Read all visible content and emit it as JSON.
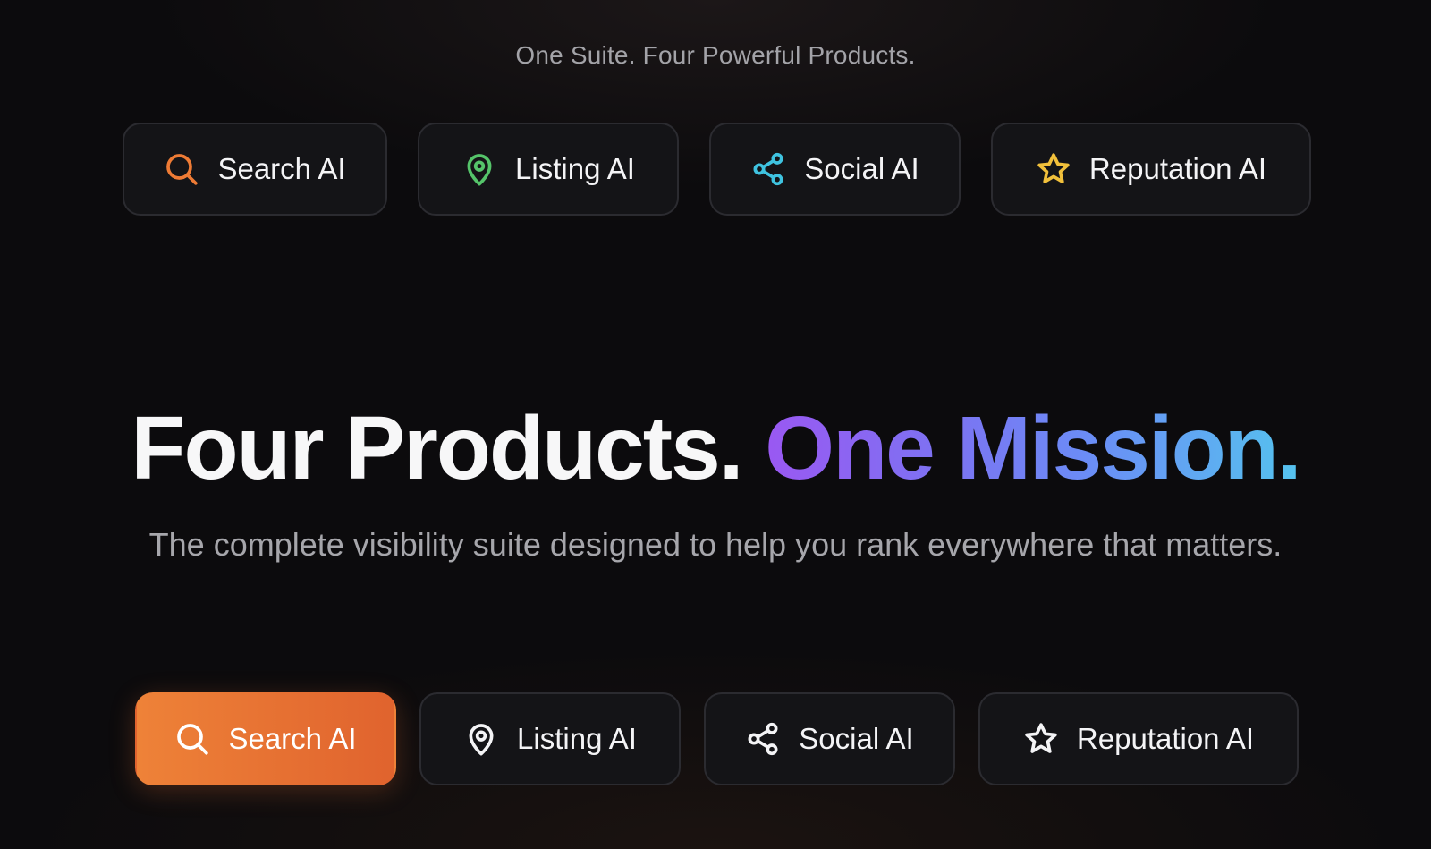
{
  "hero": {
    "eyebrow": "One Suite. Four Powerful Products.",
    "headline_part1": "Four Products.",
    "headline_part2": "One Mission.",
    "subheadline": "The complete visibility suite designed to help you rank everywhere that matters."
  },
  "top_products": [
    {
      "label": "Search AI",
      "icon": "search-icon",
      "color": "#ee7b35"
    },
    {
      "label": "Listing AI",
      "icon": "map-pin-icon",
      "color": "#55c46a"
    },
    {
      "label": "Social AI",
      "icon": "share-icon",
      "color": "#3fc3e0"
    },
    {
      "label": "Reputation AI",
      "icon": "star-icon",
      "color": "#f1c03b"
    }
  ],
  "tabs": {
    "active_index": 0,
    "items": [
      {
        "label": "Search AI",
        "icon": "search-icon"
      },
      {
        "label": "Listing AI",
        "icon": "map-pin-icon"
      },
      {
        "label": "Social AI",
        "icon": "share-icon"
      },
      {
        "label": "Reputation AI",
        "icon": "star-icon"
      }
    ]
  },
  "colors": {
    "background": "#0c0b0d",
    "active_tab_start": "#ee8238",
    "active_tab_end": "#e0632e",
    "headline_gradient_start": "#9a58f2",
    "headline_gradient_end": "#55c3ee"
  }
}
